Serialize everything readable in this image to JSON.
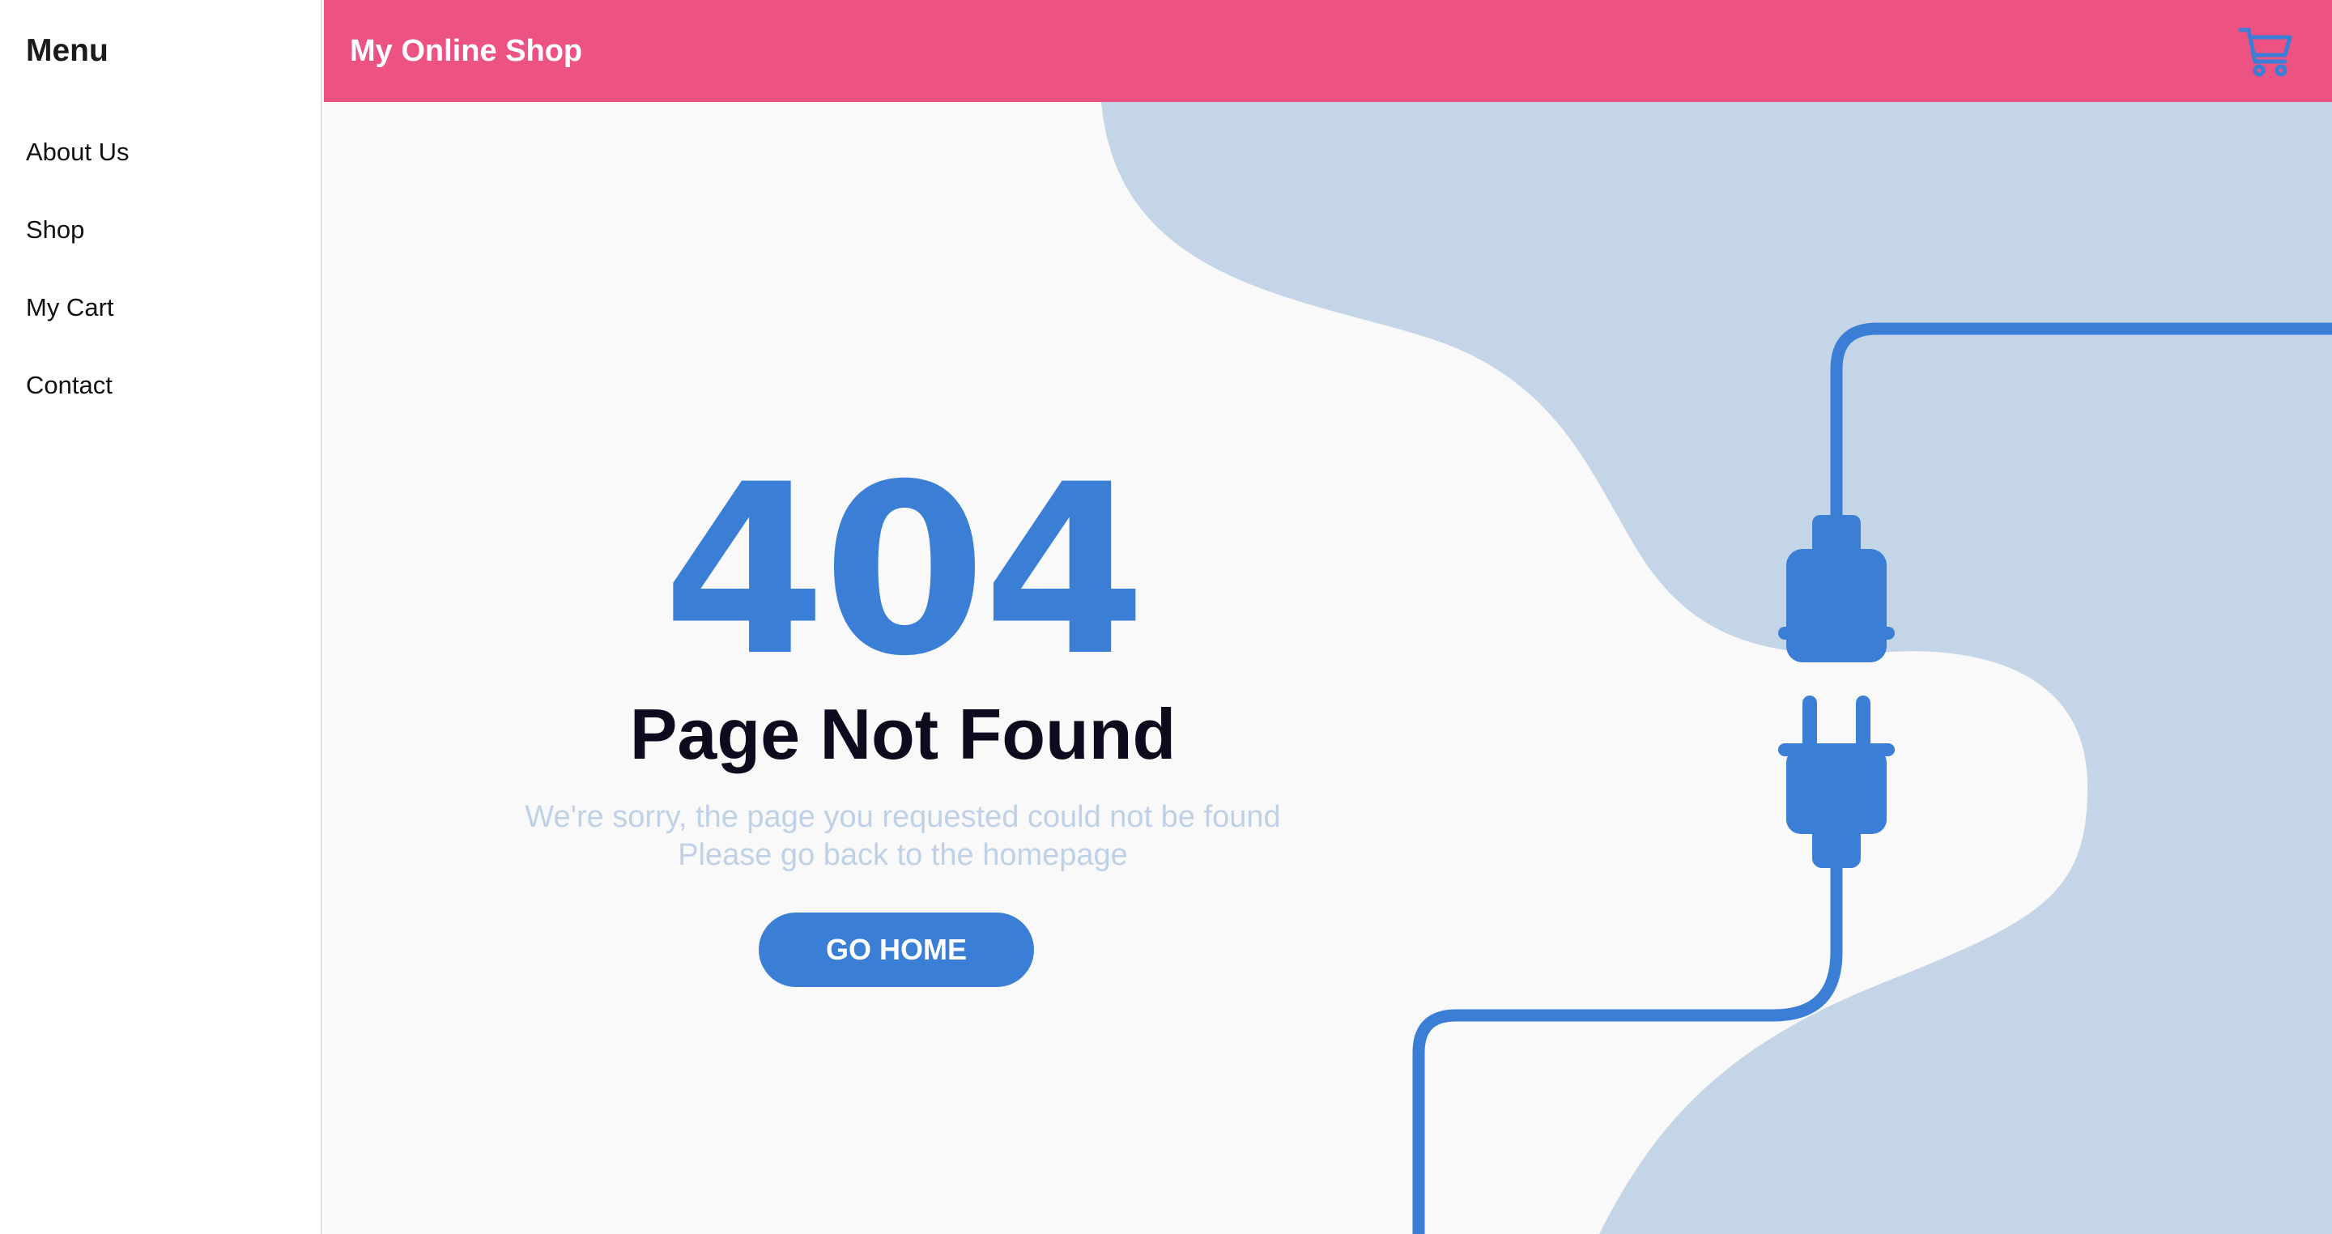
{
  "sidebar": {
    "title": "Menu",
    "items": [
      {
        "label": "About Us"
      },
      {
        "label": "Shop"
      },
      {
        "label": "My Cart"
      },
      {
        "label": "Contact"
      }
    ]
  },
  "header": {
    "title": "My Online Shop",
    "cart_icon": "shopping-cart-icon"
  },
  "error": {
    "code": "404",
    "title": "Page Not Found",
    "message_line1": "We're sorry, the page you requested could not be found",
    "message_line2": "Please go back to the homepage",
    "button_label": "GO HOME"
  },
  "illustration": {
    "icon": "unplugged-cable-icon"
  },
  "colors": {
    "header_bg": "#ec5282",
    "accent_blue": "#3a7fd5",
    "wave_bg": "#c4d5e7",
    "page_bg": "#f9f9f9",
    "title_text": "#0c0c1e",
    "muted_text": "#bfd1e6"
  }
}
